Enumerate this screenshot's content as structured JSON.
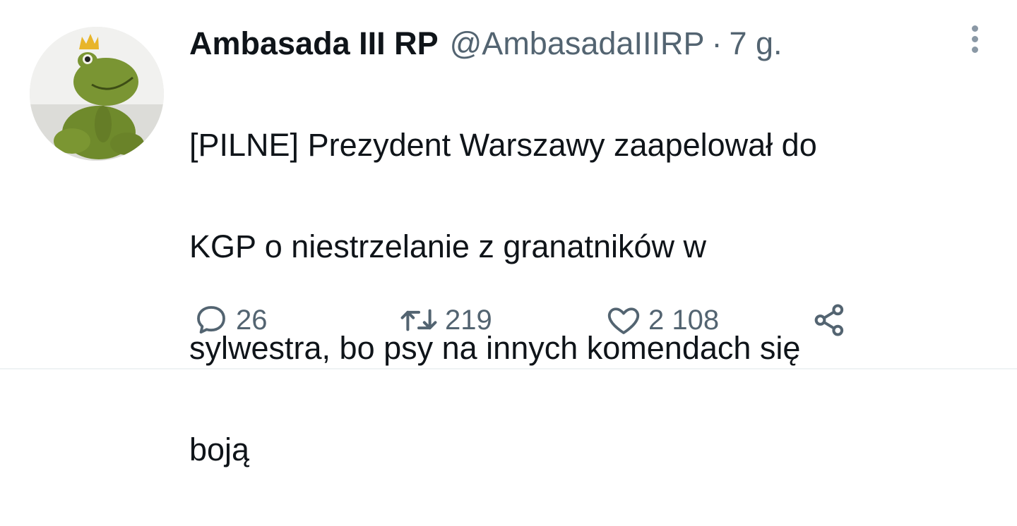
{
  "tweet": {
    "author_name": "Ambasada III RP",
    "handle": "@AmbasadaIIIRP",
    "separator": "·",
    "time": "7 g.",
    "text_lines": [
      "[PILNE] Prezydent Warszawy zaapelował do",
      "KGP o niestrzelanie z granatników w",
      "sylwestra, bo psy na innych komendach się",
      "boją"
    ],
    "stats": {
      "replies": "26",
      "retweets": "219",
      "likes": "2 108"
    }
  },
  "colors": {
    "text": "#0f1419",
    "secondary": "#536471",
    "divider": "#eff3f4"
  },
  "icons": {
    "more": "more-vertical-icon",
    "reply": "reply-icon",
    "retweet": "retweet-icon",
    "like": "heart-icon",
    "share": "share-icon"
  }
}
